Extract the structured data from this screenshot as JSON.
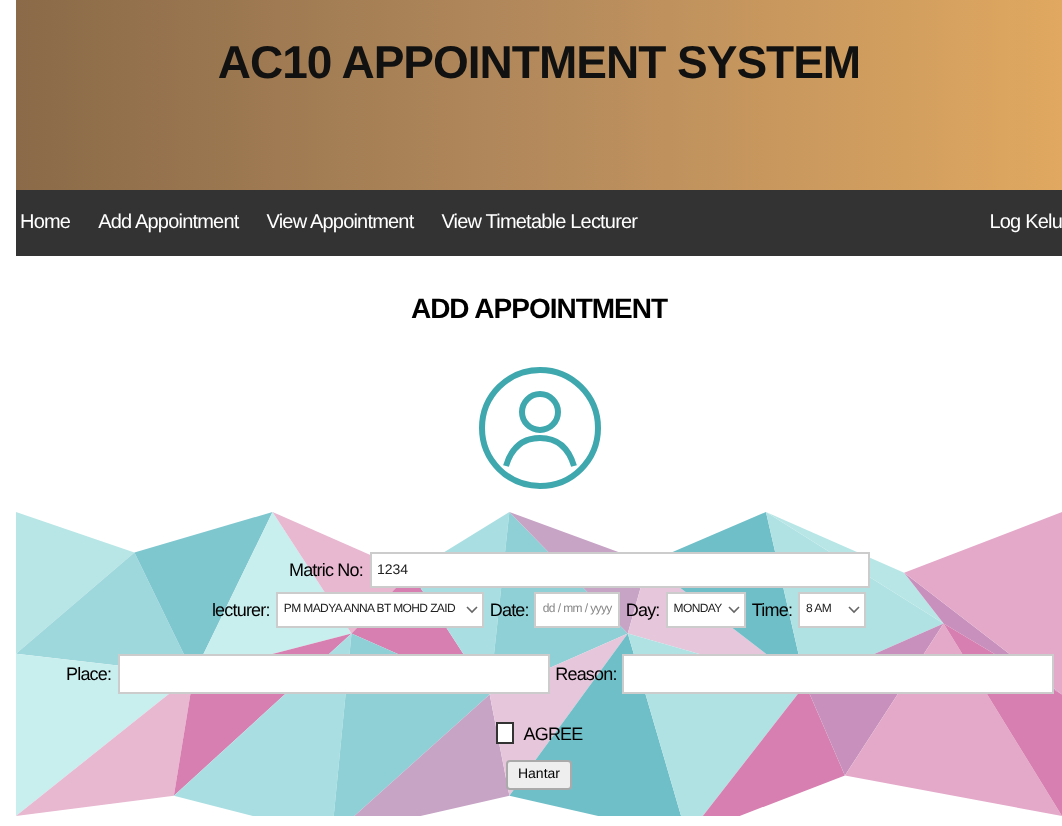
{
  "header": {
    "title": "AC10 APPOINTMENT SYSTEM"
  },
  "nav": {
    "items": [
      {
        "label": "Home"
      },
      {
        "label": "Add Appointment"
      },
      {
        "label": "View Appointment"
      },
      {
        "label": "View Timetable Lecturer"
      }
    ],
    "logout": "Log Kelu"
  },
  "page_title": "ADD APPOINTMENT",
  "form": {
    "matric_label": "Matric No:",
    "matric_value": "1234",
    "lecturer_label": "lecturer:",
    "lecturer_value": "PM MADYA ANNA BT MOHD ZAID",
    "date_label": "Date:",
    "date_placeholder": "dd / mm / yyyy",
    "day_label": "Day:",
    "day_value": "MONDAY",
    "time_label": "Time:",
    "time_value": "8 AM",
    "place_label": "Place:",
    "reason_label": "Reason:",
    "agree_label": "AGREE",
    "agree_checked": false,
    "submit": "Hantar"
  }
}
